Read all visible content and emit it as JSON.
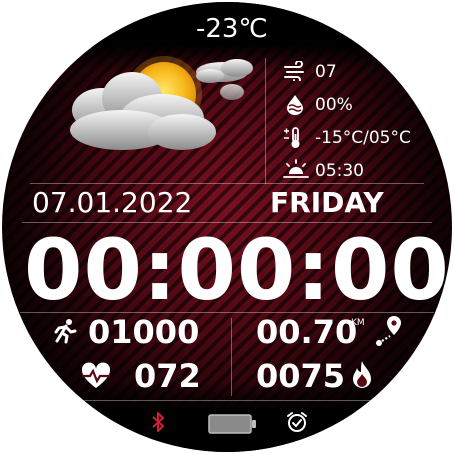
{
  "temperature": "-23℃",
  "weather": {
    "icon": "partly-cloudy-icon",
    "wind": "07",
    "humidity": "00%",
    "temp_range": "-15°C/05°C",
    "sunrise": "05:30"
  },
  "date": "07.01.2022",
  "weekday": "FRIDAY",
  "time": "00:00:00",
  "stats": {
    "steps": "01000",
    "heart_rate": "072",
    "distance": "00.70",
    "distance_unit": "KM",
    "calories": "0075"
  },
  "status": {
    "bluetooth_icon": "bluetooth-icon",
    "battery_icon": "battery-icon",
    "alarm_icon": "alarm-icon"
  },
  "colors": {
    "accent_red": "#d21d35",
    "text": "#ffffff"
  }
}
